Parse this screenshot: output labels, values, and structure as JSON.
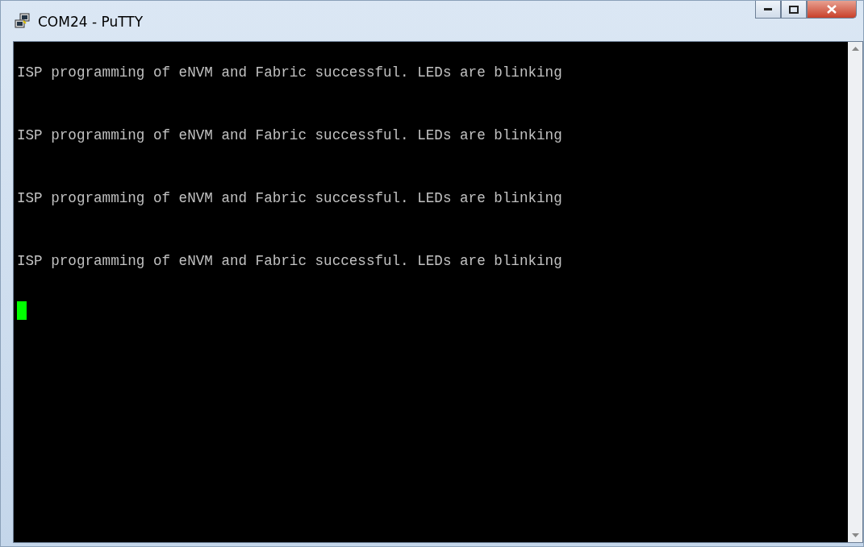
{
  "window": {
    "title": "COM24 - PuTTY"
  },
  "terminal": {
    "lines": [
      "ISP programming of eNVM and Fabric successful. LEDs are blinking",
      "ISP programming of eNVM and Fabric successful. LEDs are blinking",
      "ISP programming of eNVM and Fabric successful. LEDs are blinking",
      "ISP programming of eNVM and Fabric successful. LEDs are blinking"
    ],
    "cursor": true
  }
}
